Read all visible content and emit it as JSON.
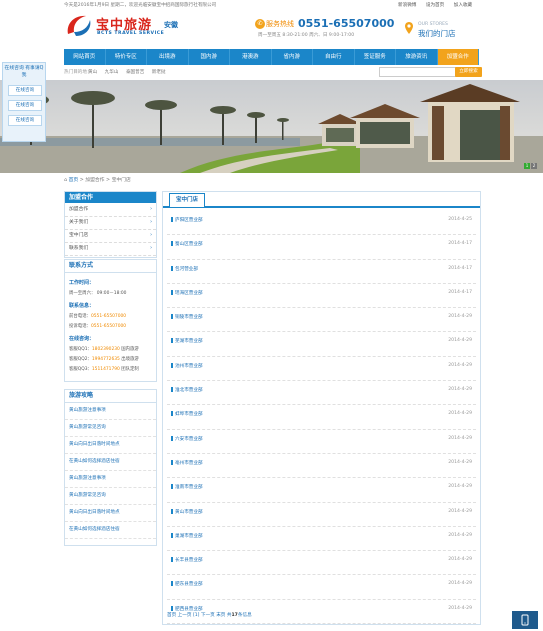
{
  "topbar": {
    "welcome": "今天是2016年1月9日 星期二，欢迎光临安徽宝中招商国际旅行社有限公司",
    "links": [
      "新浪微博",
      "设为首页",
      "加入收藏"
    ]
  },
  "logo": {
    "brand_cn": "宝中旅游",
    "city": "安徽",
    "brand_en": "BCTS TRAVEL SERVICE"
  },
  "hotline": {
    "label": "服务热线",
    "number": "0551-65507000",
    "hours": "周一至周五 8:30-21:00  周六、日 9:00-17:00"
  },
  "stores": {
    "en": "OUR STORES",
    "cn": "我们的门店"
  },
  "nav": [
    "网站首页",
    "特价专区",
    "出境游",
    "国内游",
    "港澳游",
    "省内游",
    "自由行",
    "签证服务",
    "旅游资讯",
    "加盟合作"
  ],
  "search": {
    "hot_label": "热门目的地：",
    "hot_words": [
      "黄山",
      "九华山",
      "泰国普吉",
      "新老挝"
    ],
    "placeholder": "",
    "button": "立即搜索"
  },
  "float_qq": {
    "title": "在线咨询\n有事请Q我",
    "buttons": [
      "在线咨询",
      "在线咨询",
      "在线咨询"
    ]
  },
  "banner_pager": [
    "1",
    "2"
  ],
  "breadcrumb": {
    "home": "首页",
    "sep": ">",
    "c1": "加盟合作",
    "c2": "宝中门店"
  },
  "sidebar": {
    "head": "加盟合作",
    "items": [
      "加盟合作",
      "关于我们",
      "宝中门店",
      "联系我们"
    ]
  },
  "contact": {
    "head": "联系方式",
    "work_label": "工作时间：",
    "work_text": "周一至周六： 09:00－18:00",
    "info_label": "联系信息：",
    "lines": [
      {
        "k": "前台电话：",
        "v": "0551-65507000"
      },
      {
        "k": "投诉电话：",
        "v": "0551-65507000"
      }
    ],
    "online_label": "在线咨询：",
    "qq": [
      {
        "k": "客服QQ1：",
        "v": "1802390230",
        "t": "国内旅游"
      },
      {
        "k": "客服QQ2：",
        "v": "1994772635",
        "t": "出境旅游"
      },
      {
        "k": "客服QQ3：",
        "v": "1511471790",
        "t": "团队定制"
      }
    ]
  },
  "guide": {
    "head": "旅游攻略",
    "items": [
      "黄山旅游注意事项",
      "黄山旅游常见咨询",
      "黄山向日出日落时间地点",
      "在黄山如何选择酒店住宿",
      "黄山旅游注意事项",
      "黄山旅游常见咨询",
      "黄山向日出日落时间地点",
      "在黄山如何选择酒店住宿"
    ]
  },
  "main": {
    "tab": "宝中门店",
    "rows": [
      {
        "title": "庐阳区营业部",
        "date": "2014-4-25"
      },
      {
        "title": "蜀山区营业部",
        "date": "2014-4-17"
      },
      {
        "title": "包河营业部",
        "date": "2014-4-17"
      },
      {
        "title": "瑶海区营业部",
        "date": "2014-4-17"
      },
      {
        "title": "铜陵市营业部",
        "date": "2014-4-29"
      },
      {
        "title": "芜湖市营业部",
        "date": "2014-4-29"
      },
      {
        "title": "池州市营业部",
        "date": "2014-4-29"
      },
      {
        "title": "淮北市营业部",
        "date": "2014-4-29"
      },
      {
        "title": "蚌埠市营业部",
        "date": "2014-4-29"
      },
      {
        "title": "六安市营业部",
        "date": "2014-4-29"
      },
      {
        "title": "亳州市营业部",
        "date": "2014-4-29"
      },
      {
        "title": "淮南市营业部",
        "date": "2014-4-29"
      },
      {
        "title": "黄山市营业部",
        "date": "2014-4-29"
      },
      {
        "title": "巢湖市营业部",
        "date": "2014-4-29"
      },
      {
        "title": "长丰县营业部",
        "date": "2014-4-29"
      },
      {
        "title": "肥东县营业部",
        "date": "2014-4-29"
      },
      {
        "title": "肥西县营业部",
        "date": "2014-4-29"
      }
    ],
    "pagination": {
      "first": "首页",
      "prev": "上一页",
      "cur": "[1]",
      "next": "下一页",
      "last": "末页",
      "total_pre": "共",
      "total": "17",
      "total_post": "条信息"
    }
  },
  "colors": {
    "brand_blue": "#1b86c9",
    "accent_orange": "#f2a31c",
    "logo_red": "#d9261c"
  }
}
